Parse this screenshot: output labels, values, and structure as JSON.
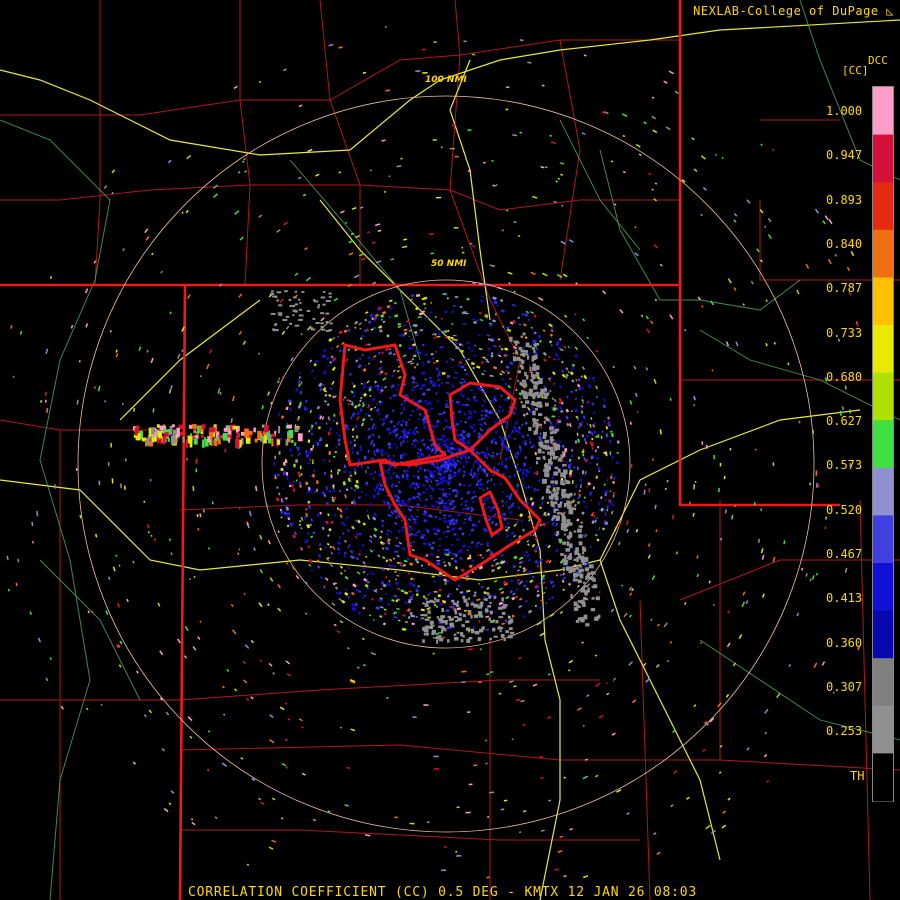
{
  "header": {
    "credit": "NEXLAB-College of DuPage",
    "product_code": "DCC",
    "product_unit": "[CC]"
  },
  "map": {
    "range_rings": [
      {
        "label": "100 NMI"
      },
      {
        "label": "50 NMI"
      }
    ]
  },
  "color_scale": {
    "ticks": [
      "1.000",
      "0.947",
      "0.893",
      "0.840",
      "0.787",
      "0.733",
      "0.680",
      "0.627",
      "0.573",
      "0.520",
      "0.467",
      "0.413",
      "0.360",
      "0.307",
      "0.253",
      "TH"
    ],
    "colors": [
      "#ff9ec8",
      "#d4103a",
      "#e42a10",
      "#f07010",
      "#ffc000",
      "#e8e800",
      "#b0e000",
      "#40e040",
      "#9090d0",
      "#4040e0",
      "#1010d8",
      "#0808b0",
      "#808080",
      "#909090",
      "#000000"
    ]
  },
  "footer": {
    "caption": "CORRELATION COEFFICIENT (CC) 0.5 DEG - KMTX 12 JAN 26 08:03"
  }
}
